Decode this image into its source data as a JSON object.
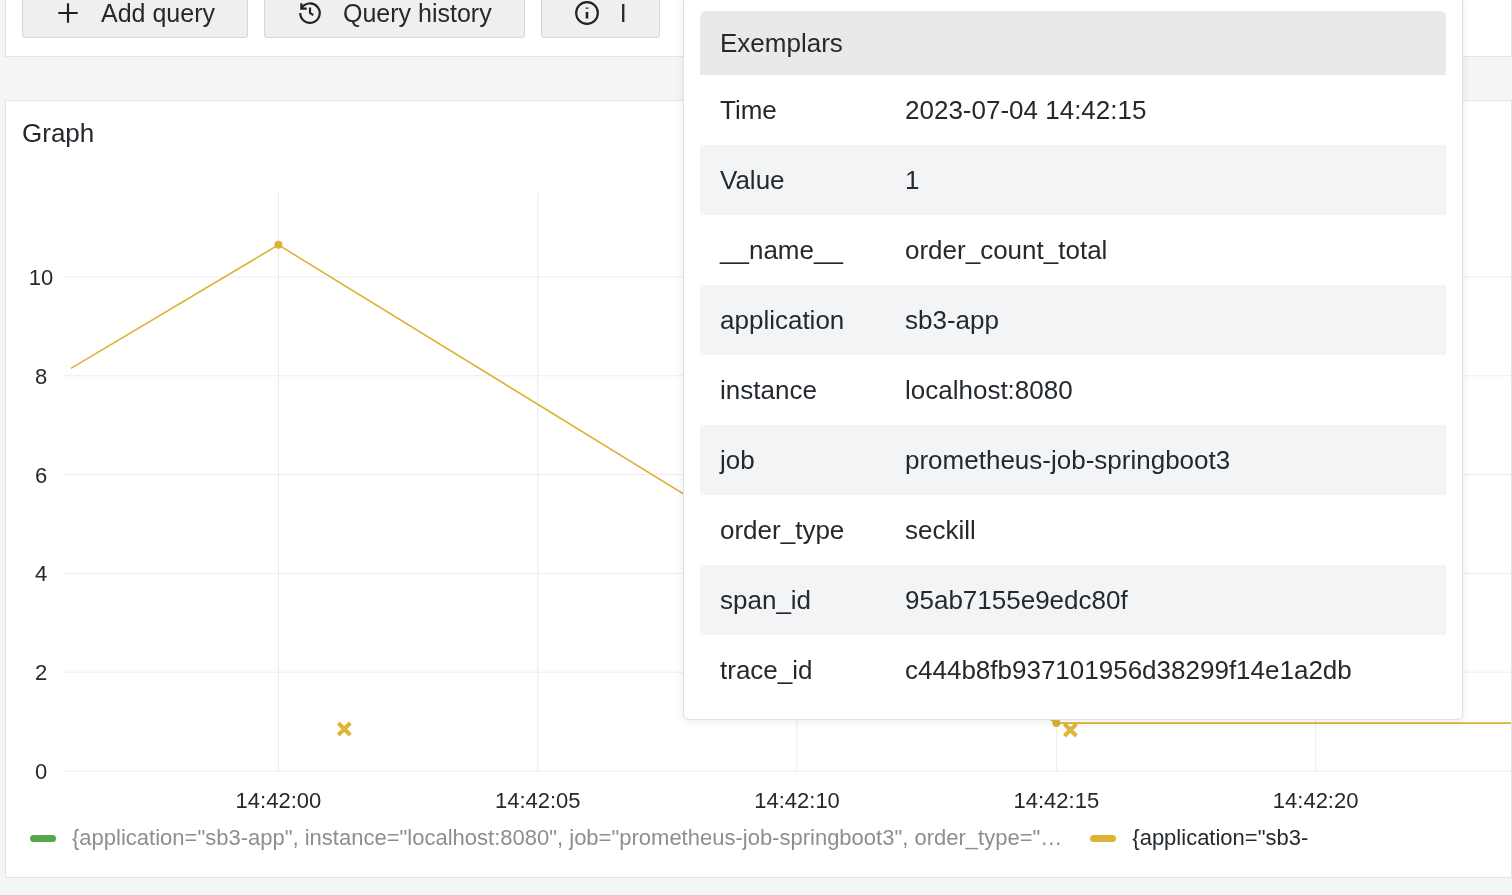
{
  "toolbar": {
    "buttons": [
      {
        "kind": "add",
        "label": "Add query"
      },
      {
        "kind": "history",
        "label": "Query history"
      },
      {
        "kind": "info",
        "label": "I"
      }
    ]
  },
  "graph": {
    "title": "Graph",
    "chart_data": {
      "type": "line",
      "categories": [
        null,
        null,
        null,
        null,
        "14:42:00",
        null,
        null,
        null,
        null,
        "14:42:05",
        null,
        null,
        null,
        null,
        "14:42:10",
        null,
        null,
        null,
        null,
        "14:42:15",
        null,
        null,
        null,
        null,
        "14:42:20",
        null,
        null,
        null,
        null
      ],
      "ylim": [
        0,
        11.7
      ],
      "grid": true,
      "yticks": [
        0,
        2,
        4,
        6,
        8,
        10
      ],
      "series": [
        {
          "color": "#dcb237",
          "values": [
            8.15,
            null,
            null,
            null,
            10.65,
            null,
            null,
            null,
            null,
            null,
            null,
            null,
            null,
            null,
            null,
            null,
            null,
            null,
            null,
            0.97,
            null,
            null,
            null,
            null,
            null,
            null,
            null,
            null,
            0.97
          ]
        },
        {
          "type": "scatter",
          "color": "#e0b43a",
          "values": [
            null,
            null,
            null,
            null,
            null,
            0.85,
            null,
            null,
            null,
            null,
            null,
            null,
            null,
            null,
            null,
            null,
            null,
            null,
            null,
            0.83,
            null,
            null,
            null,
            null,
            null,
            null,
            null,
            null,
            null
          ]
        }
      ]
    },
    "legend": [
      {
        "label": "{application=\"sb3-app\", instance=\"localhost:8080\", job=\"prometheus-job-springboot3\", order_type=\"…",
        "color": "#56a64b",
        "hidden": true
      },
      {
        "label": "{application=\"sb3-",
        "color": "#dcb237",
        "hidden": false
      }
    ]
  },
  "tooltip": {
    "title": "Exemplars",
    "rows": [
      {
        "key": "Time",
        "value": "2023-07-04 14:42:15"
      },
      {
        "key": "Value",
        "value": "1"
      },
      {
        "key": "__name__",
        "value": "order_count_total"
      },
      {
        "key": "application",
        "value": "sb3-app"
      },
      {
        "key": "instance",
        "value": "localhost:8080"
      },
      {
        "key": "job",
        "value": "prometheus-job-springboot3"
      },
      {
        "key": "order_type",
        "value": "seckill"
      },
      {
        "key": "span_id",
        "value": "95ab7155e9edc80f"
      },
      {
        "key": "trace_id",
        "value": "c444b8fb937101956d38299f14e1a2db"
      }
    ]
  }
}
